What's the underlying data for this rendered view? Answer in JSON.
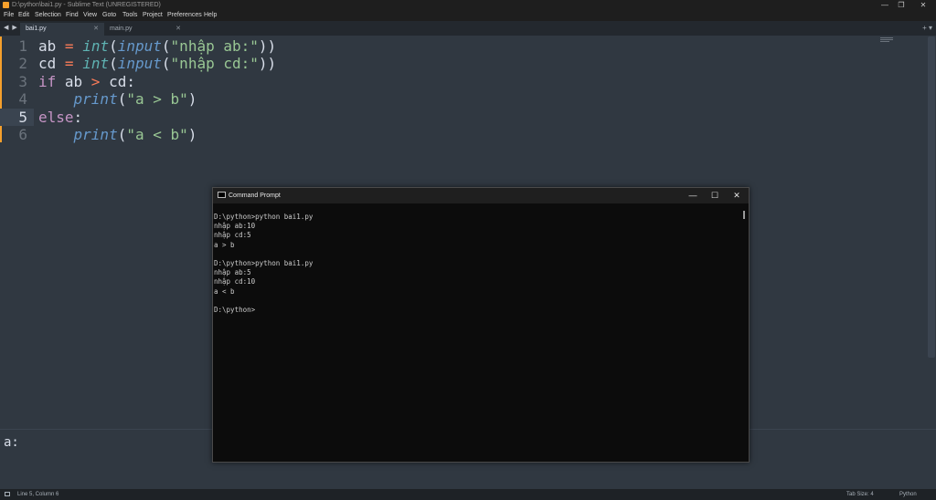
{
  "window": {
    "title": "D:\\python\\bai1.py - Sublime Text (UNREGISTERED)",
    "controls": {
      "minimize": "—",
      "maximize": "❐",
      "close": "✕"
    }
  },
  "menu": [
    "File",
    "Edit",
    "Selection",
    "Find",
    "View",
    "Goto",
    "Tools",
    "Project",
    "Preferences",
    "Help"
  ],
  "tabs": {
    "nav": "◀ ▶",
    "items": [
      {
        "label": "bai1.py",
        "close": "✕",
        "active": true
      },
      {
        "label": "main.py",
        "close": "✕",
        "active": false
      }
    ],
    "tools": "+ ▾"
  },
  "editor": {
    "current_line": 5,
    "lines": [
      {
        "num": "1",
        "tokens": [
          {
            "t": "ab ",
            "c": "pl"
          },
          {
            "t": "=",
            "c": "op"
          },
          {
            "t": " ",
            "c": "pl"
          },
          {
            "t": "int",
            "c": "fn"
          },
          {
            "t": "(",
            "c": "pl"
          },
          {
            "t": "input",
            "c": "fn2"
          },
          {
            "t": "(",
            "c": "pl"
          },
          {
            "t": "\"nhập ab:\"",
            "c": "str"
          },
          {
            "t": "))",
            "c": "pl"
          }
        ]
      },
      {
        "num": "2",
        "tokens": [
          {
            "t": "cd ",
            "c": "pl"
          },
          {
            "t": "=",
            "c": "op"
          },
          {
            "t": " ",
            "c": "pl"
          },
          {
            "t": "int",
            "c": "fn"
          },
          {
            "t": "(",
            "c": "pl"
          },
          {
            "t": "input",
            "c": "fn2"
          },
          {
            "t": "(",
            "c": "pl"
          },
          {
            "t": "\"nhập cd:\"",
            "c": "str"
          },
          {
            "t": "))",
            "c": "pl"
          }
        ]
      },
      {
        "num": "3",
        "tokens": [
          {
            "t": "if",
            "c": "kw"
          },
          {
            "t": " ab ",
            "c": "pl"
          },
          {
            "t": ">",
            "c": "op"
          },
          {
            "t": " cd:",
            "c": "pl"
          }
        ]
      },
      {
        "num": "4",
        "tokens": [
          {
            "t": "    ",
            "c": "pl"
          },
          {
            "t": "print",
            "c": "fn2"
          },
          {
            "t": "(",
            "c": "pl"
          },
          {
            "t": "\"a > b\"",
            "c": "str"
          },
          {
            "t": ")",
            "c": "pl"
          }
        ]
      },
      {
        "num": "5",
        "tokens": [
          {
            "t": "else",
            "c": "kw"
          },
          {
            "t": ":",
            "c": "pl"
          }
        ]
      },
      {
        "num": "6",
        "tokens": [
          {
            "t": "    ",
            "c": "pl"
          },
          {
            "t": "print",
            "c": "fn2"
          },
          {
            "t": "(",
            "c": "pl"
          },
          {
            "t": "\"a < b\"",
            "c": "str"
          },
          {
            "t": ")",
            "c": "pl"
          }
        ]
      }
    ]
  },
  "console": {
    "prompt": "a:"
  },
  "status": {
    "position": "Line 5, Column 6",
    "tab_size": "Tab Size: 4",
    "syntax": "Python"
  },
  "cmd": {
    "title": "Command Prompt",
    "controls": {
      "minimize": "—",
      "maximize": "☐",
      "close": "✕"
    },
    "lines": [
      "D:\\python>python bai1.py",
      "nhập ab:10",
      "nhập cd:5",
      "a > b",
      "",
      "D:\\python>python bai1.py",
      "nhập ab:5",
      "nhập cd:10",
      "a < b",
      "",
      "D:\\python>"
    ]
  },
  "colors": {
    "editor_bg": "#303841",
    "accent": "#f6a02c",
    "keyword": "#c594c5",
    "function": "#5fb3b3",
    "builtin": "#6699cc",
    "string": "#99c794",
    "operator": "#f97b58",
    "cmd_bg": "#0c0c0c"
  }
}
